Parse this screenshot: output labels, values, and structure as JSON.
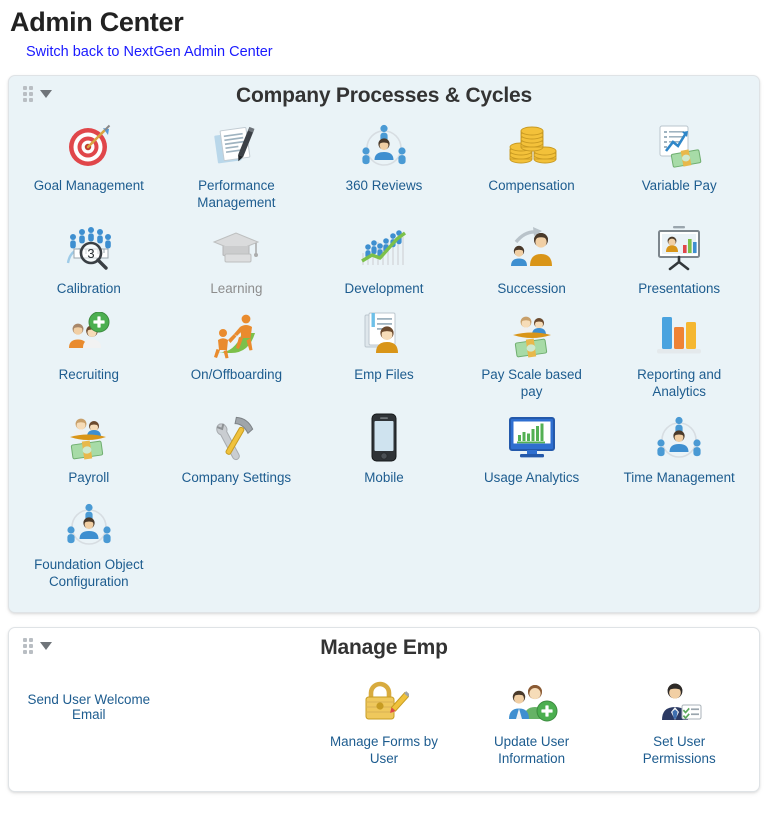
{
  "header": {
    "title": "Admin Center",
    "switch_link": "Switch back to NextGen Admin Center",
    "link_color": "#1a1aff"
  },
  "panels": [
    {
      "title": "Company Processes & Cycles",
      "background": "#eaf3f7",
      "drag_handle_icon": "drag-handle-icon",
      "collapse_icon": "chevron-down-icon",
      "tiles": [
        {
          "label": "Goal Management",
          "icon": "target-icon",
          "disabled": false
        },
        {
          "label": "Performance Management",
          "icon": "document-pen-icon",
          "disabled": false
        },
        {
          "label": "360 Reviews",
          "icon": "people-circle-icon",
          "disabled": false
        },
        {
          "label": "Compensation",
          "icon": "coin-stacks-icon",
          "disabled": false
        },
        {
          "label": "Variable Pay",
          "icon": "chart-money-icon",
          "disabled": false
        },
        {
          "label": "Calibration",
          "icon": "calibration-icon",
          "disabled": false
        },
        {
          "label": "Learning",
          "icon": "graduation-cap-icon",
          "disabled": true
        },
        {
          "label": "Development",
          "icon": "growth-people-icon",
          "disabled": false
        },
        {
          "label": "Succession",
          "icon": "succession-arrow-icon",
          "disabled": false
        },
        {
          "label": "Presentations",
          "icon": "projector-screen-icon",
          "disabled": false
        },
        {
          "label": "Recruiting",
          "icon": "people-plus-icon",
          "disabled": false
        },
        {
          "label": "On/Offboarding",
          "icon": "onboarding-slope-icon",
          "disabled": false
        },
        {
          "label": "Emp Files",
          "icon": "employee-file-icon",
          "disabled": false
        },
        {
          "label": "Pay Scale based pay",
          "icon": "payscale-money-icon",
          "disabled": false
        },
        {
          "label": "Reporting and Analytics",
          "icon": "bar-chart-icon",
          "disabled": false
        },
        {
          "label": "Payroll",
          "icon": "payroll-money-icon",
          "disabled": false
        },
        {
          "label": "Company Settings",
          "icon": "tools-icon",
          "disabled": false
        },
        {
          "label": "Mobile",
          "icon": "smartphone-icon",
          "disabled": false
        },
        {
          "label": "Usage Analytics",
          "icon": "monitor-chart-icon",
          "disabled": false
        },
        {
          "label": "Time Management",
          "icon": "people-circle-icon",
          "disabled": false
        },
        {
          "label": "Foundation Object Configuration",
          "icon": "people-circle-icon",
          "disabled": false
        }
      ]
    },
    {
      "title": "Manage Emp",
      "background": "#ffffff",
      "drag_handle_icon": "drag-handle-icon",
      "collapse_icon": "chevron-down-icon",
      "text_link": "Send User Welcome Email",
      "tiles": [
        {
          "label": "Manage Forms by User",
          "icon": "padlock-pencil-icon",
          "disabled": false
        },
        {
          "label": "Update User Information",
          "icon": "people-add-icon",
          "disabled": false
        },
        {
          "label": "Set User Permissions",
          "icon": "person-checklist-icon",
          "disabled": false
        }
      ]
    }
  ]
}
